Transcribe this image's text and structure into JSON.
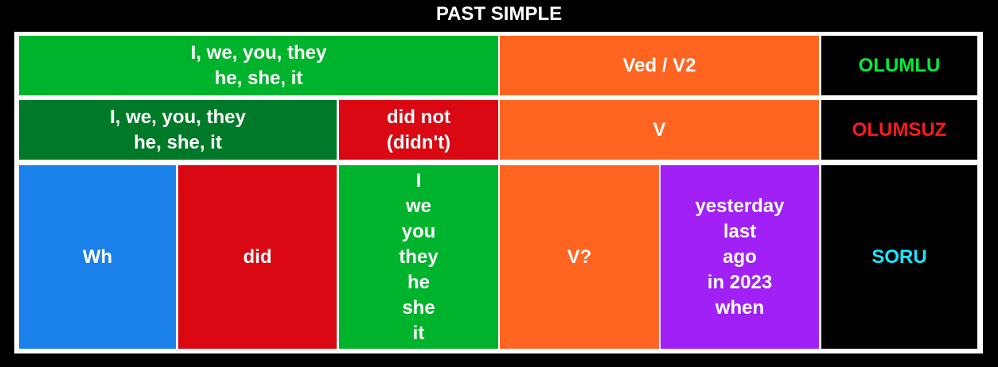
{
  "title": "PAST SIMPLE",
  "colors": {
    "green": "#00b32c",
    "dark_green": "#007a28",
    "orange": "#ff6520",
    "red": "#d90812",
    "blue": "#1a80ea",
    "purple": "#a020f5",
    "black": "#000000",
    "olumlu_label": "#00ee3a",
    "olumsuz_label": "#ff1a1a",
    "soru_label": "#19e6ff"
  },
  "row_positive": {
    "subjects": [
      "I, we, you, they",
      "he, she, it"
    ],
    "verb": "Ved / V2",
    "label": "OLUMLU"
  },
  "row_negative": {
    "subjects": [
      "I, we, you, they",
      "he, she, it"
    ],
    "aux": [
      "did not",
      "(didn't)"
    ],
    "verb": "V",
    "label": "OLUMSUZ"
  },
  "row_question": {
    "wh": "Wh",
    "aux": "did",
    "subjects": [
      "I",
      "we",
      "you",
      "they",
      "he",
      "she",
      "it"
    ],
    "verb": "V?",
    "time_words": [
      "yesterday",
      "last",
      "ago",
      "in 2023",
      "when"
    ],
    "label": "SORU"
  }
}
